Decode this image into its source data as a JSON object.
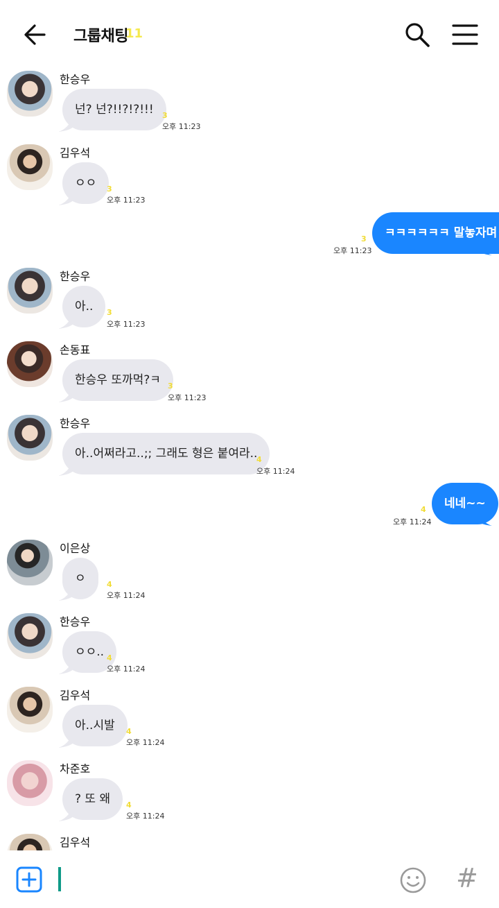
{
  "header": {
    "title": "그룹채팅",
    "member_count": "11",
    "icons": {
      "back": "arrow-left-icon",
      "search": "search-icon",
      "menu": "hamburger-menu-icon"
    }
  },
  "messages": [
    {
      "sender": "한승우",
      "text": "넌? 넌?!!?!?!!!",
      "unread": "3",
      "time": "오후 11:23",
      "outgoing": false
    },
    {
      "sender": "김우석",
      "text": "ㅇㅇ",
      "unread": "3",
      "time": "오후 11:23",
      "outgoing": false
    },
    {
      "sender": "",
      "text": "ㅋㅋㅋㅋㅋㅋ 말놓자며ㅋ",
      "unread": "3",
      "time": "오후 11:23",
      "outgoing": true
    },
    {
      "sender": "한승우",
      "text": "아..",
      "unread": "3",
      "time": "오후 11:23",
      "outgoing": false
    },
    {
      "sender": "손동표",
      "text": "한승우 또까먹?ㅋ",
      "unread": "3",
      "time": "오후 11:23",
      "outgoing": false
    },
    {
      "sender": "한승우",
      "text": "아..어쩌라고..;; 그래도 형은 붙여라..",
      "unread": "4",
      "time": "오후 11:24",
      "outgoing": false
    },
    {
      "sender": "",
      "text": "네네~~",
      "unread": "4",
      "time": "오후 11:24",
      "outgoing": true
    },
    {
      "sender": "이은상",
      "text": "ㅇ",
      "unread": "4",
      "time": "오후 11:24",
      "outgoing": false
    },
    {
      "sender": "한승우",
      "text": "ㅇㅇ..",
      "unread": "4",
      "time": "오후 11:24",
      "outgoing": false
    },
    {
      "sender": "김우석",
      "text": "아..시발",
      "unread": "4",
      "time": "오후 11:24",
      "outgoing": false
    },
    {
      "sender": "차준호",
      "text": "? 또 왜",
      "unread": "4",
      "time": "오후 11:24",
      "outgoing": false
    },
    {
      "sender": "김우석",
      "text": "",
      "unread": "",
      "time": "",
      "outgoing": false
    }
  ],
  "colors": {
    "incoming_bubble": "#e8e8ee",
    "outgoing_bubble": "#1a86ff",
    "unread": "#f1dc37",
    "cursor": "#0f9a88"
  },
  "input_bar": {
    "value": "",
    "icons": {
      "add": "plus-box-icon",
      "emoji": "smiley-icon",
      "hashtag": "hashtag-icon"
    },
    "hashtag_glyph": "#"
  }
}
